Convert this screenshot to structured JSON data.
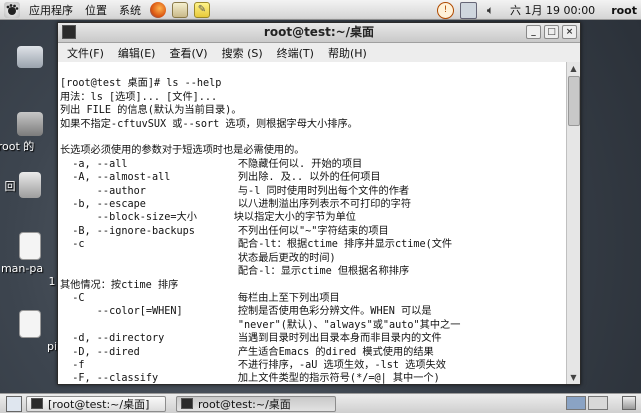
{
  "top_panel": {
    "menu": [
      "应用程序",
      "位置",
      "系统"
    ],
    "clock": "六 1月 19 00:00",
    "user": "root",
    "launcher_icons": [
      "firefox-icon",
      "mail-icon",
      "notes-icon"
    ],
    "tray_icons": [
      "update-icon",
      "network-icon",
      "volume-icon"
    ]
  },
  "desktop": {
    "icons": [
      {
        "label": "root 的"
      },
      {
        "label": "回"
      },
      {
        "label": "man-pa"
      },
      {
        "label": "1"
      },
      {
        "label": "pi"
      }
    ]
  },
  "window": {
    "title": "root@test:~/桌面",
    "menu": [
      "文件(F)",
      "编辑(E)",
      "查看(V)",
      "搜索 (S)",
      "终端(T)",
      "帮助(H)"
    ],
    "terminal_lines": [
      "",
      "[root@test 桌面]# ls --help",
      "用法：ls [选项]... [文件]...",
      "列出 FILE 的信息(默认为当前目录)。",
      "如果不指定-cftuvSUX 或--sort 选项，则根据字母大小排序。",
      "",
      "长选项必须使用的参数对于短选项时也是必需使用的。",
      "  -a, --all                  不隐藏任何以. 开始的项目",
      "  -A, --almost-all           列出除. 及.. 以外的任何项目",
      "      --author               与-l 同时使用时列出每个文件的作者",
      "  -b, --escape               以八进制溢出序列表示不可打印的字符",
      "      --block-size=大小      块以指定大小的字节为单位",
      "  -B, --ignore-backups       不列出任何以\"~\"字符结束的项目",
      "  -c                         配合-lt：根据ctime 排序并显示ctime(文件",
      "                             状态最后更改的时间)",
      "                             配合-l：显示ctime 但根据名称排序",
      "其他情况：按ctime 排序",
      "  -C                         每栏由上至下列出项目",
      "      --color[=WHEN]         控制是否使用色彩分辨文件。WHEN 可以是",
      "                             \"never\"(默认)、\"always\"或\"auto\"其中之一",
      "  -d, --directory            当遇到目录时列出目录本身而非目录内的文件",
      "  -D, --dired                产生适合Emacs 的dired 模式使用的结果",
      "  -f                         不进行排序，-aU 选项生效，-lst 选项失效",
      "  -F, --classify             加上文件类型的指示符号(*/=@| 其中一个)"
    ]
  },
  "taskbar": {
    "tasks": [
      "[root@test:~/桌面]",
      "root@test:~/桌面"
    ]
  }
}
